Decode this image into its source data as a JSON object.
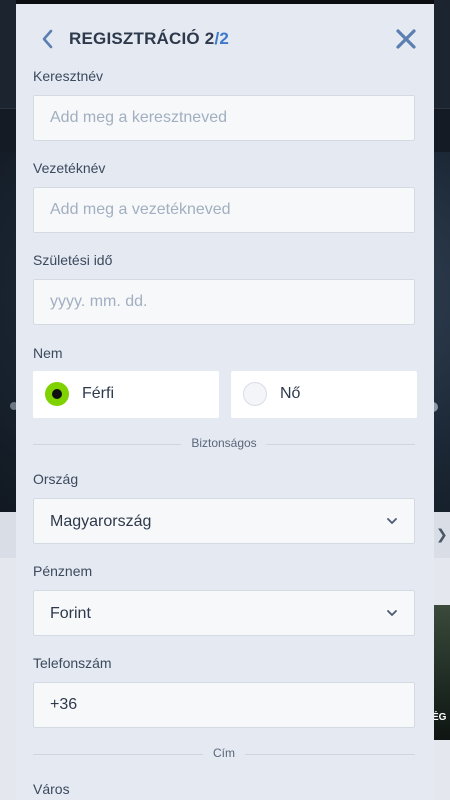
{
  "header": {
    "title": "REGISZTRÁCIÓ 2",
    "step": "/2",
    "back_icon": "chevron-left-icon",
    "close_icon": "close-icon"
  },
  "form": {
    "first_name": {
      "label": "Keresztnév",
      "placeholder": "Add meg a keresztneved",
      "value": ""
    },
    "last_name": {
      "label": "Vezetéknév",
      "placeholder": "Add meg a vezetékneved",
      "value": ""
    },
    "birth_date": {
      "label": "Születési idő",
      "placeholder": "yyyy. mm. dd.",
      "value": ""
    },
    "gender": {
      "label": "Nem",
      "options": [
        {
          "label": "Férfi",
          "selected": true
        },
        {
          "label": "Nő",
          "selected": false
        }
      ]
    },
    "security_divider": "Biztonságos",
    "country": {
      "label": "Ország",
      "value": "Magyarország"
    },
    "currency": {
      "label": "Pénznem",
      "value": "Forint"
    },
    "phone": {
      "label": "Telefonszám",
      "value": "+36"
    },
    "address_divider": "Cím",
    "city": {
      "label": "Város"
    }
  },
  "background": {
    "card_text": "ÉG"
  },
  "colors": {
    "accent": "#3c79c9",
    "radio_selected": "#7fd100",
    "modal_bg": "#e4e9f2"
  }
}
